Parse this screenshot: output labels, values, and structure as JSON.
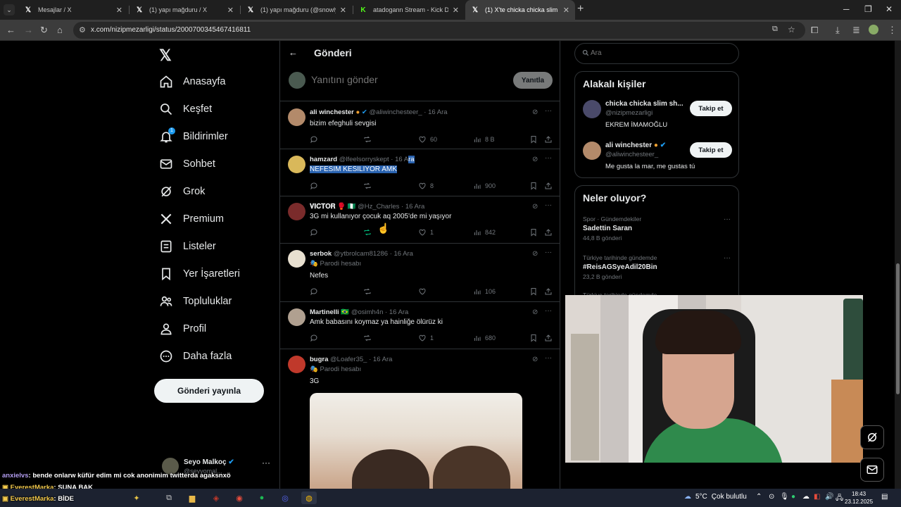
{
  "browser": {
    "tabs": [
      {
        "title": "Mesajlar / X",
        "icon": "x"
      },
      {
        "title": "(1) yapı mağduru / X",
        "icon": "x"
      },
      {
        "title": "(1) yapı mağduru (@snowlyebr",
        "icon": "x"
      },
      {
        "title": "atadogann Stream - Kick Dashb",
        "icon": "kick"
      },
      {
        "title": "(1) X'te chicka chicka slim shady",
        "icon": "x",
        "active": true
      }
    ],
    "url": "x.com/nizipmezarligi/status/2000700345467416811"
  },
  "nav": {
    "items": [
      {
        "label": "Anasayfa",
        "icon": "home-icon"
      },
      {
        "label": "Keşfet",
        "icon": "search-icon"
      },
      {
        "label": "Bildirimler",
        "icon": "bell-icon",
        "badge": "1"
      },
      {
        "label": "Sohbet",
        "icon": "mail-icon"
      },
      {
        "label": "Grok",
        "icon": "grok-icon"
      },
      {
        "label": "Premium",
        "icon": "x-icon"
      },
      {
        "label": "Listeler",
        "icon": "list-icon"
      },
      {
        "label": "Yer İşaretleri",
        "icon": "bookmark-icon"
      },
      {
        "label": "Topluluklar",
        "icon": "people-icon"
      },
      {
        "label": "Profil",
        "icon": "person-icon"
      },
      {
        "label": "Daha fazla",
        "icon": "more-circle-icon"
      }
    ],
    "post_button": "Gönderi yayınla",
    "account": {
      "name": "Seyo Malkoç",
      "handle": "@seyyomal..."
    }
  },
  "main": {
    "title": "Gönderi",
    "reply_placeholder": "Yanıtını gönder",
    "reply_button": "Yanıtla",
    "tweets": [
      {
        "name": "ali winchester",
        "badge": "🟠",
        "verified": true,
        "handle": "@aliwinchesteer_",
        "date": "16 Ara",
        "text": "bizim efeghuli sevgisi",
        "replies": "",
        "retweets": "",
        "likes": "60",
        "views": "8 B"
      },
      {
        "name": "hamzard",
        "handle": "@lfeelsorryskept",
        "date": "16 A",
        "date_highlight": "ra",
        "text_highlight": "NEFESIM KESILIYOR AMK",
        "likes": "8",
        "views": "900"
      },
      {
        "name": "𝐕𝐈𝐂𝐓𝐎𝐑 🥊 🇳🇬",
        "handle": "@Hz_Charles",
        "date": "16 Ara",
        "text": "3G mi kullanıyor çocuk aq 2005'de mi yaşıyor",
        "likes": "1",
        "views": "842"
      },
      {
        "name": "serbok",
        "handle": "@ytbrolcam81286",
        "date": "16 Ara",
        "parody": "Parodi hesabı",
        "text": "Nefes",
        "likes": "",
        "views": "106"
      },
      {
        "name": "Martinelli 🇧🇷",
        "handle": "@osimh4n",
        "date": "16 Ara",
        "text": "Amk babasını koymaz ya hainliğe ölürüz ki",
        "likes": "1",
        "views": "680"
      },
      {
        "name": "bugra",
        "handle": "@Loafer35_",
        "date": "16 Ara",
        "parody": "Parodi hesabı",
        "text": "3G"
      }
    ]
  },
  "right": {
    "search_placeholder": "Ara",
    "related_title": "Alakalı kişiler",
    "people": [
      {
        "name": "chicka chicka slim sh...",
        "handle": "@nizipmezarligi",
        "bio": "EKREM İMAMOĞLU",
        "button": "Takip et"
      },
      {
        "name": "ali winchester",
        "badge": "🟠",
        "verified": true,
        "handle": "@aliwinchesteer_",
        "bio": "Me gusta la mar, me gustas tú",
        "button": "Takip et"
      }
    ],
    "trends_title": "Neler oluyor?",
    "trends": [
      {
        "context": "Spor · Gündemdekiler",
        "topic": "Sadettin Saran",
        "count": "44,8 B gönderi"
      },
      {
        "context": "Türkiye tarihinde gündemde",
        "topic": "#ReisAGSyeAdil20Bin",
        "count": "23,2 B gönderi"
      },
      {
        "context": "Türkiye tarihinde gündemde",
        "topic": "",
        "count": ""
      }
    ]
  },
  "chat": [
    {
      "user": "anxielvs",
      "sep": ": ",
      "msg": "bende onlarw küfür edim mi cok anonimim twitterda agaksnxö"
    },
    {
      "user": "EverestMarka",
      "sep": ": ",
      "msg": "ŞUNA BAK"
    },
    {
      "user": "EverestMarka",
      "sep": ": ",
      "msg": "BİDE"
    }
  ],
  "taskbar": {
    "temp": "5°C",
    "weather": "Çok bulutlu",
    "time": "18:43",
    "date": "23.12.2025"
  },
  "colors": {
    "accent": "#1d9bf0",
    "bg": "#000000",
    "muted": "#71767b",
    "border": "#2f3336"
  }
}
